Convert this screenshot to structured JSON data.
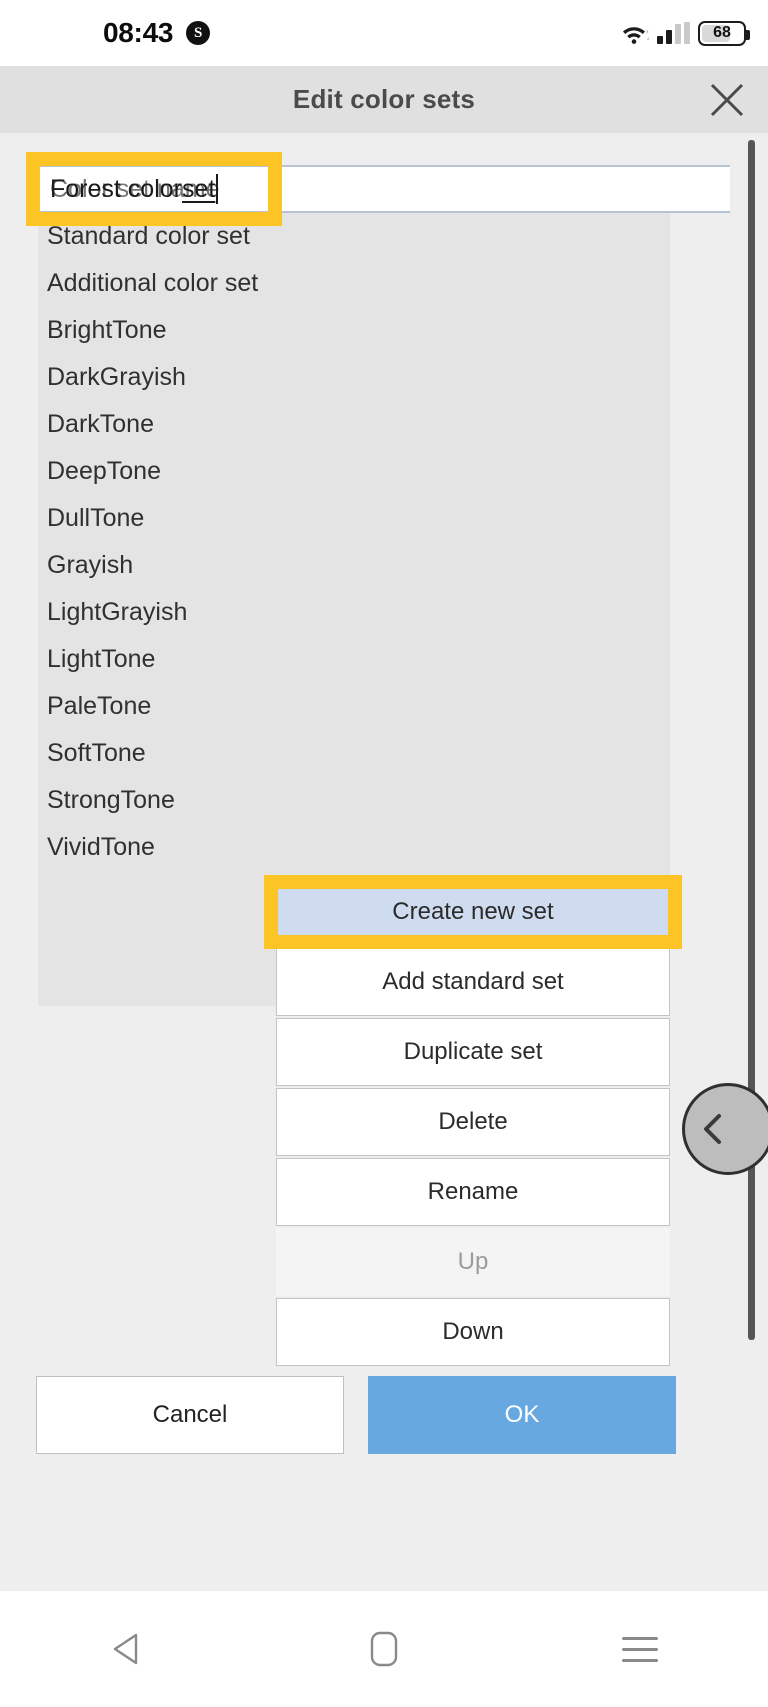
{
  "status_bar": {
    "time": "08:43",
    "badge_icon": "S",
    "wifi_icon": "wifi-icon",
    "signal_icon": "cellular-signal-icon",
    "battery_level": "68"
  },
  "dialog": {
    "title": "Edit color sets",
    "close_icon": "close-icon"
  },
  "name_field": {
    "value": "Forest color set",
    "value_plain": "Forest color ",
    "value_misspelled": "set",
    "placeholder": "Color set name"
  },
  "color_sets": [
    {
      "label": "Standard color set"
    },
    {
      "label": "Additional color set"
    },
    {
      "label": "BrightTone"
    },
    {
      "label": "DarkGrayish"
    },
    {
      "label": "DarkTone"
    },
    {
      "label": "DeepTone"
    },
    {
      "label": "DullTone"
    },
    {
      "label": "Grayish"
    },
    {
      "label": "LightGrayish"
    },
    {
      "label": "LightTone"
    },
    {
      "label": "PaleTone"
    },
    {
      "label": "SoftTone"
    },
    {
      "label": "StrongTone"
    },
    {
      "label": "VividTone"
    }
  ],
  "actions": [
    {
      "label": "Create new set",
      "state": "selected"
    },
    {
      "label": "Add standard set",
      "state": "normal"
    },
    {
      "label": "Duplicate set",
      "state": "normal"
    },
    {
      "label": "Delete",
      "state": "normal"
    },
    {
      "label": "Rename",
      "state": "normal"
    },
    {
      "label": "Up",
      "state": "disabled"
    },
    {
      "label": "Down",
      "state": "normal"
    }
  ],
  "footer": {
    "cancel_label": "Cancel",
    "ok_label": "OK"
  },
  "side_handle": {
    "icon": "chevron-left-icon"
  },
  "nav_bar": {
    "back_icon": "back-triangle-icon",
    "home_icon": "home-rounded-rect-icon",
    "recents_icon": "hamburger-menu-icon"
  },
  "colors": {
    "highlight": "#fcc424",
    "accent_ok": "#68a8e0",
    "selected_action": "#cfdcef",
    "header_bg": "#e0e0e0",
    "body_bg": "#eeeeee",
    "list_bg": "#e4e4e4"
  }
}
